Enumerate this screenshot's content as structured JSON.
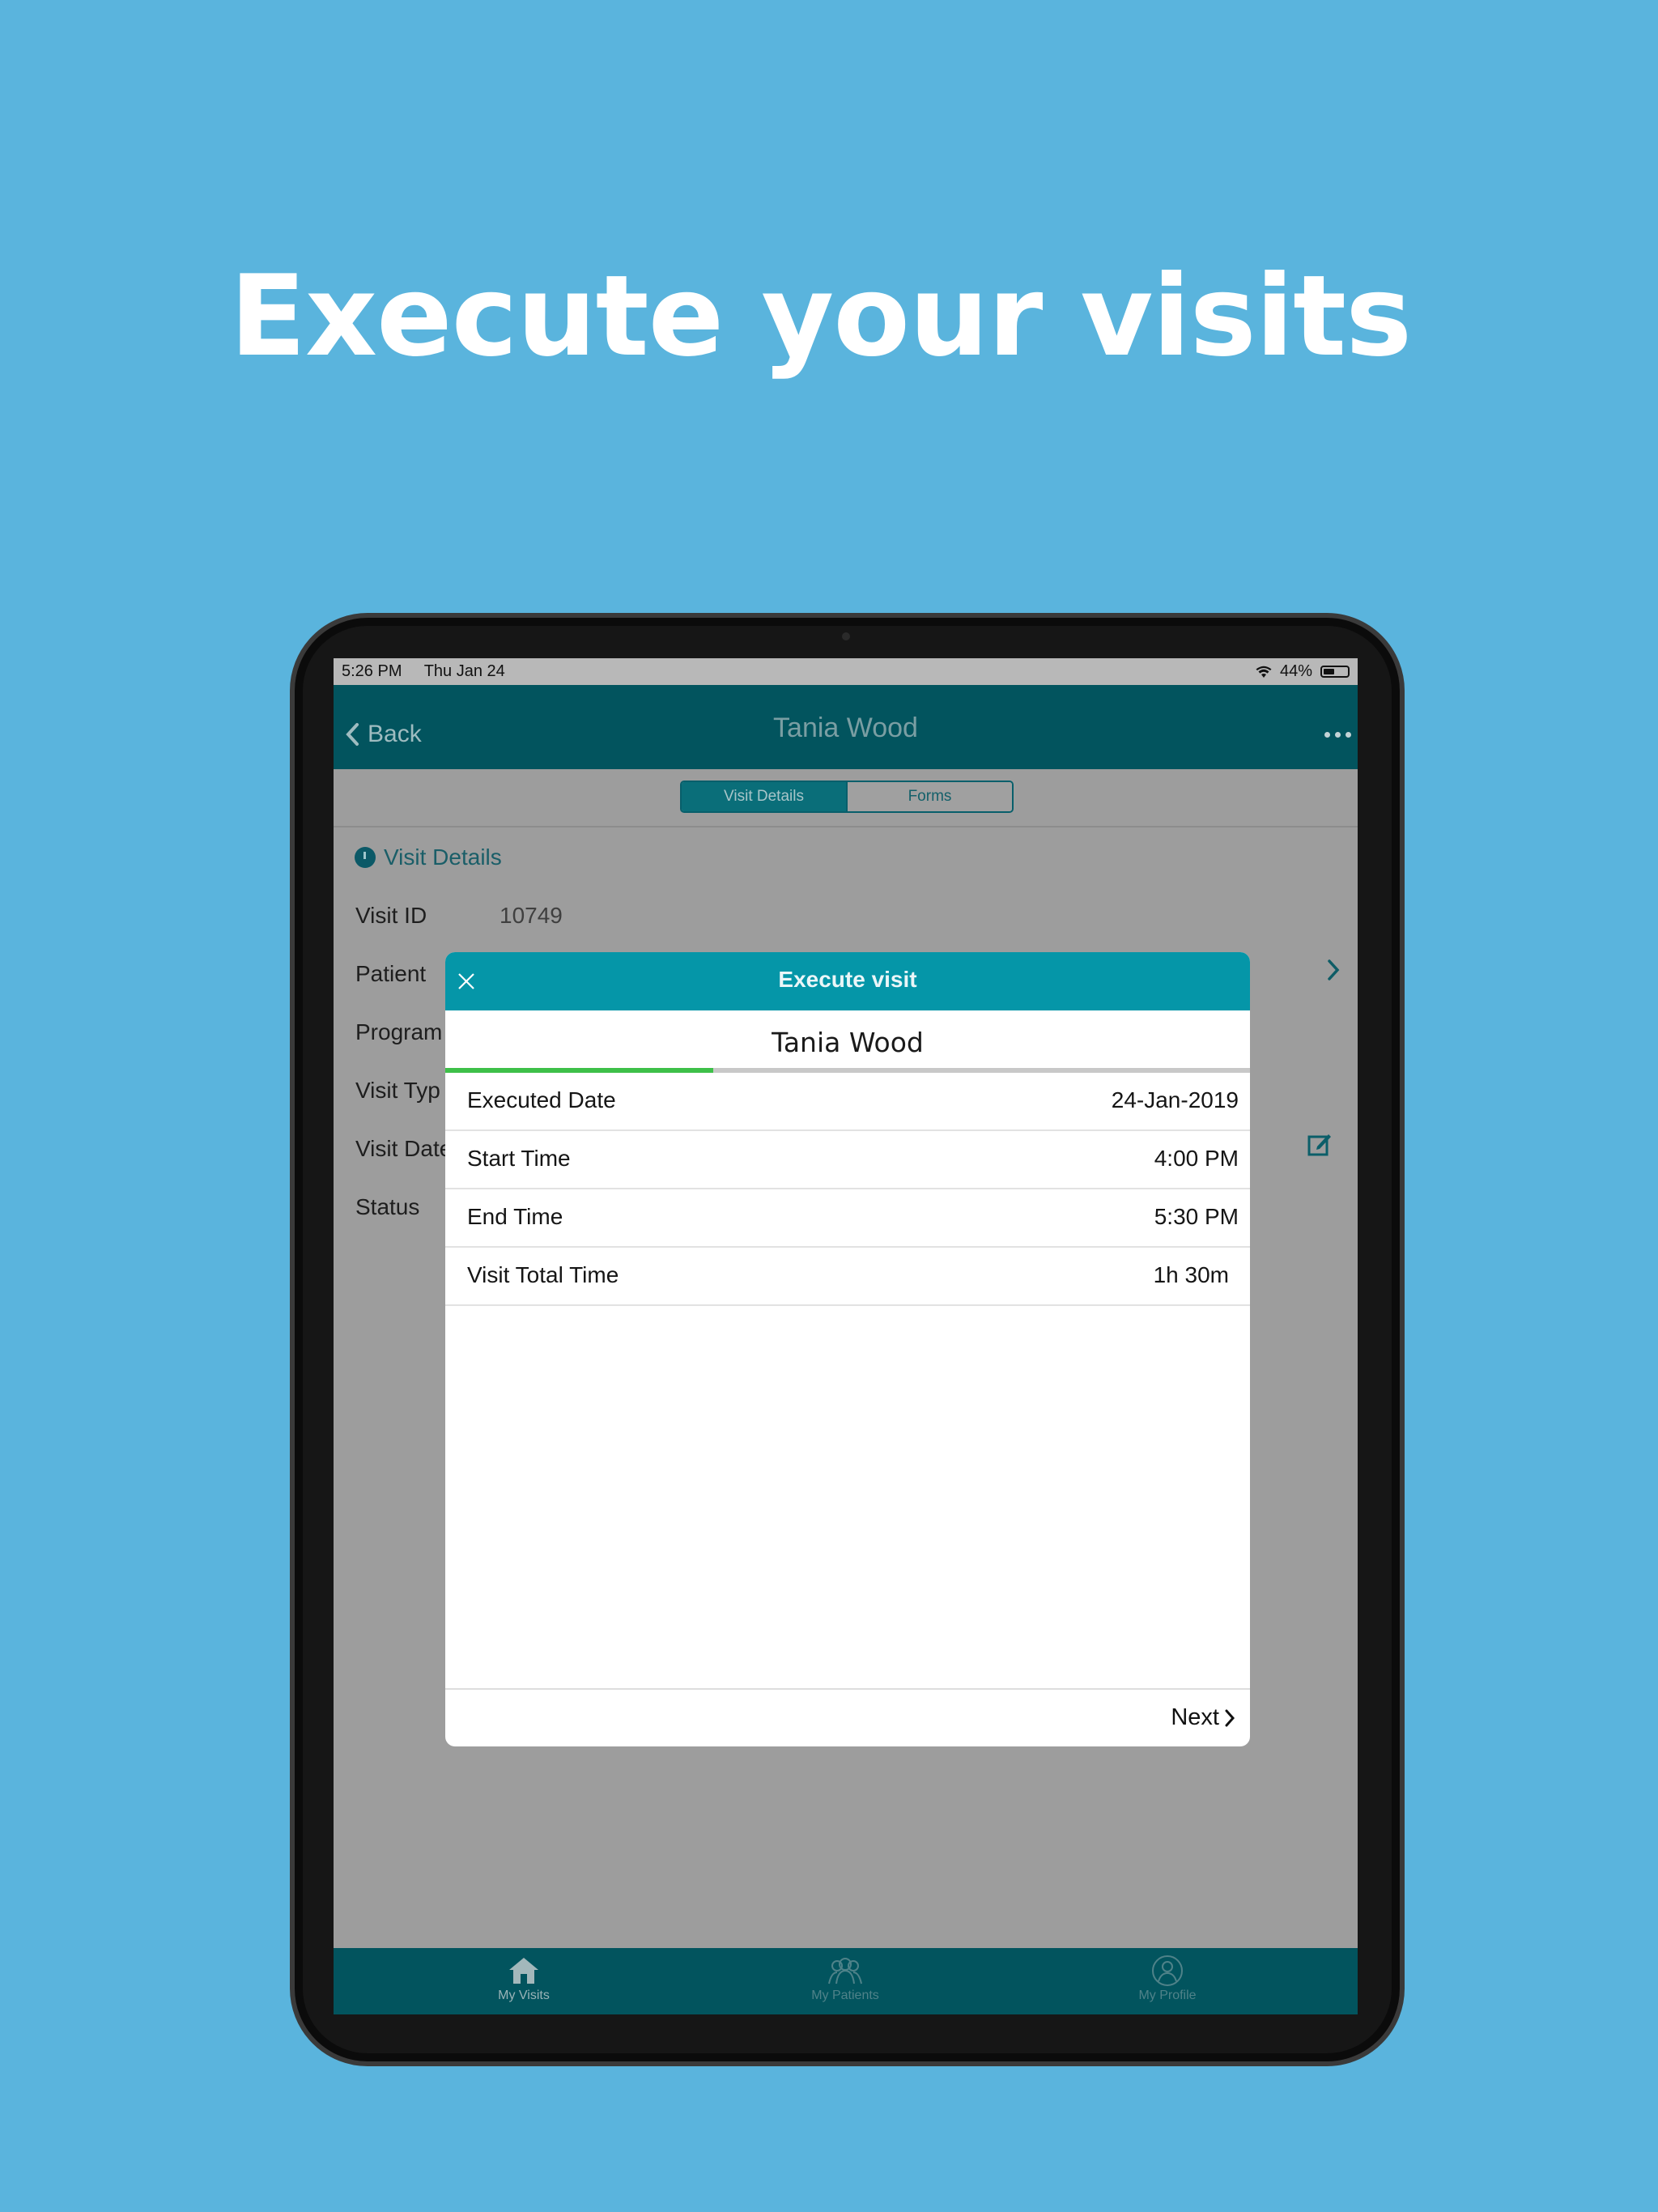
{
  "headline": "Execute your visits",
  "status_bar": {
    "time": "5:26 PM",
    "date": "Thu Jan 24",
    "battery": "44%"
  },
  "nav": {
    "back_label": "Back",
    "title": "Tania Wood"
  },
  "segments": {
    "active": "Visit Details",
    "inactive": "Forms"
  },
  "details": {
    "section_title": "Visit Details",
    "rows": [
      {
        "label": "Visit ID",
        "value": "10749"
      },
      {
        "label": "Patient"
      },
      {
        "label": "Program"
      },
      {
        "label": "Visit Typ"
      },
      {
        "label": "Visit Date"
      },
      {
        "label": "Status"
      }
    ]
  },
  "modal": {
    "title": "Execute visit",
    "patient_name": "Tania Wood",
    "progress": 0.333,
    "rows": [
      {
        "label": "Executed Date",
        "value": "24-Jan-2019"
      },
      {
        "label": "Start Time",
        "value": "4:00 PM"
      },
      {
        "label": "End Time",
        "value": "5:30 PM"
      },
      {
        "label": "Visit Total Time",
        "value": "1h 30m"
      }
    ],
    "next_label": "Next"
  },
  "tabs": [
    {
      "label": "My Visits",
      "icon": "home-icon"
    },
    {
      "label": "My Patients",
      "icon": "patients-icon"
    },
    {
      "label": "My Profile",
      "icon": "profile-icon"
    }
  ],
  "colors": {
    "background": "#5ab4dd",
    "nav": "#02545e",
    "modal_header": "#0596a8",
    "progress": "#3ec049"
  }
}
